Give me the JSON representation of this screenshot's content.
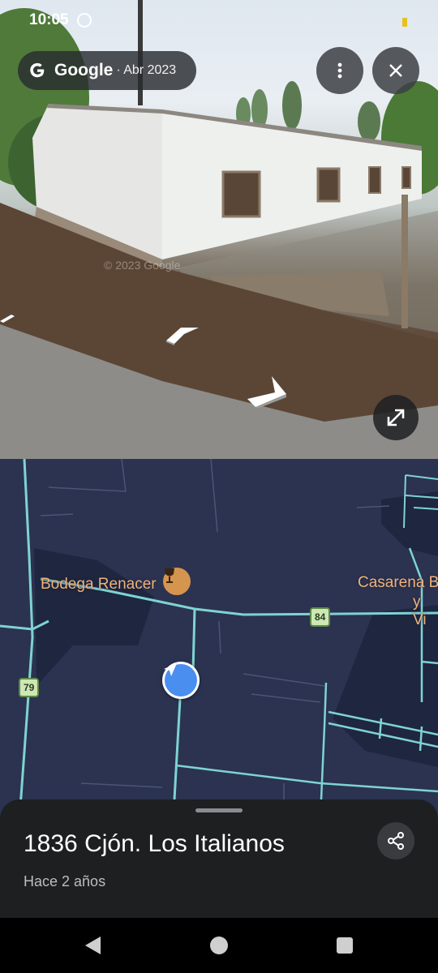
{
  "status_bar": {
    "time": "10:05",
    "icons": [
      "whatsapp-icon",
      "battery-icon"
    ]
  },
  "street_view": {
    "brand": "Google",
    "capture_date": "· Abr 2023",
    "watermark": "© 2023 Google",
    "buttons": [
      "more-icon",
      "close-icon",
      "expand-icon"
    ]
  },
  "map": {
    "pois": [
      {
        "name": "Bodega Renacer",
        "icon": "wine-glass-icon"
      },
      {
        "name_line1": "Casarena B",
        "name_line2": "y Vi"
      }
    ],
    "route_shields": [
      "84",
      "79"
    ],
    "colors": {
      "background": "#2b3350",
      "roads": "#7fd3d1",
      "poi": "#f0b27a",
      "location": "#4a8ef0"
    }
  },
  "sheet": {
    "address": "1836 Cjón. Los Italianos",
    "subtitle": "Hace 2 años",
    "share_icon": "share-icon"
  },
  "system_nav": [
    "back-icon",
    "home-icon",
    "recents-icon"
  ]
}
